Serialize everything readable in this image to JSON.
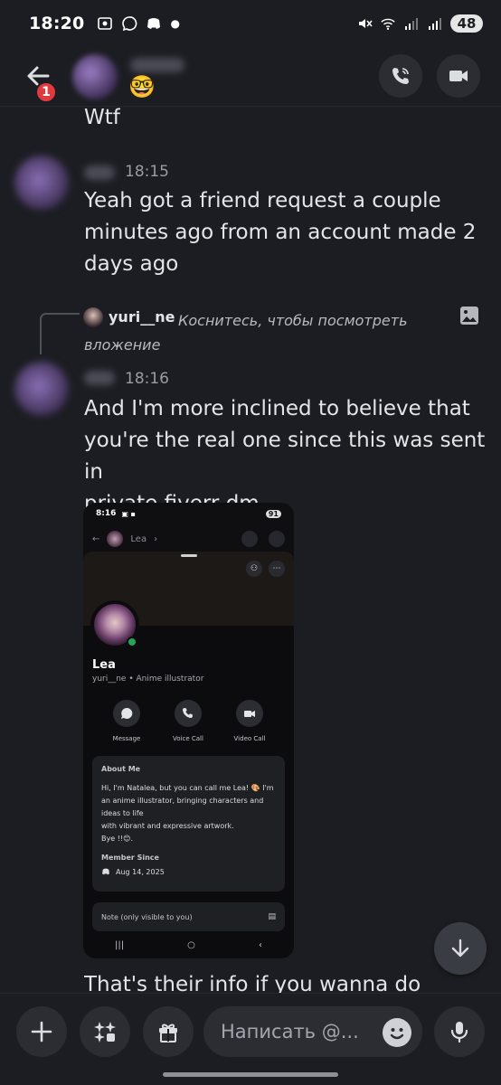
{
  "status_bar": {
    "time": "18:20",
    "battery": "48"
  },
  "header": {
    "notification_count": "1",
    "status_emoji": "🤓",
    "icons": [
      "back-arrow-icon",
      "voice-call-icon",
      "video-call-icon"
    ]
  },
  "messages": [
    {
      "time": null,
      "text": "Wtf"
    },
    {
      "time": "18:15",
      "text_lines": [
        "Yeah got a friend request a couple",
        "minutes ago from an account made 2",
        "days ago"
      ]
    },
    {
      "time": "18:16",
      "text_lines": [
        "And I'm more inclined to believe that",
        "you're the real one since this was sent in",
        "private fiverr dm"
      ]
    }
  ],
  "reply": {
    "username": "yuri__ne",
    "text": "Коснитесь, чтобы посмотреть вложение"
  },
  "attachment": {
    "time": "8:16",
    "battery": "91",
    "header_name": "Lea",
    "profile_name": "Lea",
    "profile_sub": "yuri__ne • Anime illustrator",
    "actions": [
      "Message",
      "Voice Call",
      "Video Call"
    ],
    "about_title": "About Me",
    "about_lines": [
      "Hi, I'm Natalea, but you can call me Lea! 🎨 I'm",
      "an anime illustrator, bringing characters and",
      "ideas to life",
      "with vibrant and expressive artwork.",
      "Bye !!😊."
    ],
    "member_since_title": "Member Since",
    "member_since_date": "Aug 14, 2025",
    "note_label": "Note (only visible to you)"
  },
  "last_message_partial": "That's their info if you wanna do",
  "composer": {
    "placeholder": "Написать @..."
  }
}
